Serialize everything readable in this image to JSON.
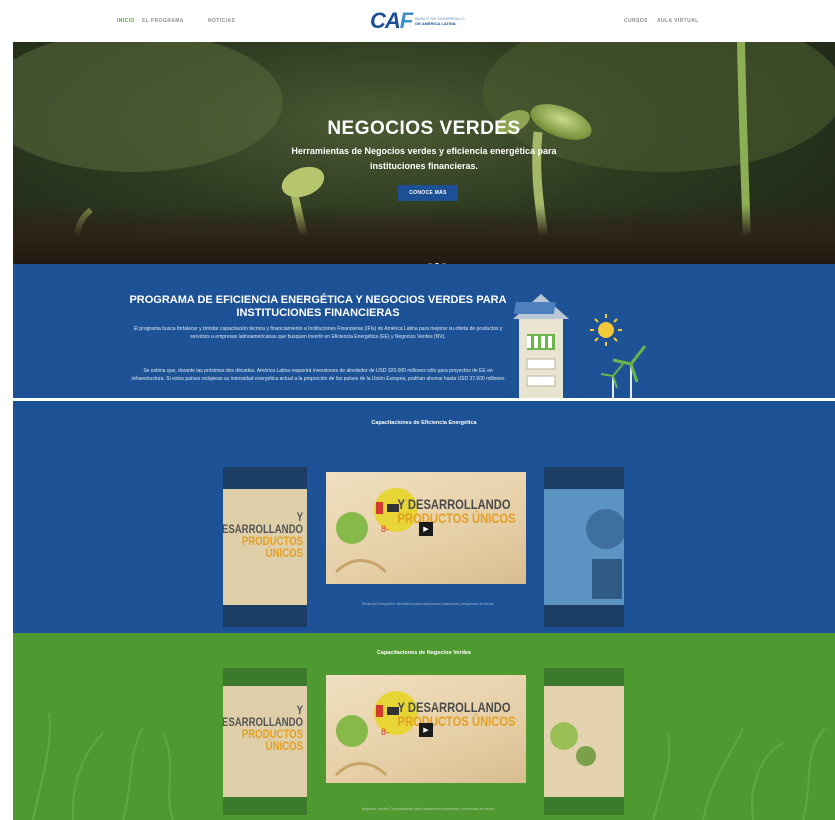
{
  "nav": {
    "left_items": [
      "INICIO",
      "EL PROGRAMA",
      "NOTICIAS"
    ],
    "right_items": [
      "CURSOS",
      "AULA VIRTUAL"
    ],
    "logo": {
      "mark": "CAF",
      "line1": "BANCO DE DESARROLLO",
      "line2": "DE AMÉRICA LATINA"
    }
  },
  "hero": {
    "title": "NEGOCIOS VERDES",
    "subtitle": "Herramientas de Negocios verdes y eficiencia energética para instituciones financieras.",
    "button": "CONOCE MÁS"
  },
  "program": {
    "title": "PROGRAMA DE EFICIENCIA ENERGÉTICA Y NEGOCIOS VERDES PARA INSTITUCIONES FINANCIERAS",
    "paragraph1": "El programa busca fortalecer y brindar capacitación técnica y financiamiento a Instituciones Financieras (IFIs) de América Latina para mejorar su oferta de productos y servicios a empresas latinoamericanas que busquen invertir en Eficiencia Energética (EE) y Negocios Verdes (NV).",
    "paragraph2": "Se estima que, durante las próximas dos décadas, América Latina requerirá inversiones de alrededor de USD 320.000 millones sólo para proyectos de EE en infraestructura. Si estos países redujeran su intensidad energética actual a la proporción de los países de la Unión Europea, podrían ahorrar hasta USD 37.600 millones"
  },
  "energy_section": {
    "title": "Capacitaciones de Eficiencia Energética",
    "video_text_line1": "Y DESARROLLANDO",
    "video_text_line2": "PRODUCTOS ÚNICOS",
    "side_text_line1": "Y DESARROLLANDO",
    "side_text_line2": "PRODUCTOS ÚNICOS",
    "caption": "Eficiencia Energética: Beneficios para instituciones financieras y empresas del sector"
  },
  "green_section": {
    "title": "Capacitaciones de Negocios Verdes",
    "video_text_line1": "Y DESARROLLANDO",
    "video_text_line2": "PRODUCTOS ÚNICOS",
    "side_text_line1": "Y DESARROLLANDO",
    "side_text_line2": "PRODUCTOS ÚNICOS",
    "caption": "Negocios Verdes: Oportunidades para instituciones financieras y empresas del sector"
  },
  "colors": {
    "blue": "#1d5396",
    "green": "#4e9a30",
    "accent_green": "#5aa832",
    "logo_blue": "#1d4f95"
  }
}
